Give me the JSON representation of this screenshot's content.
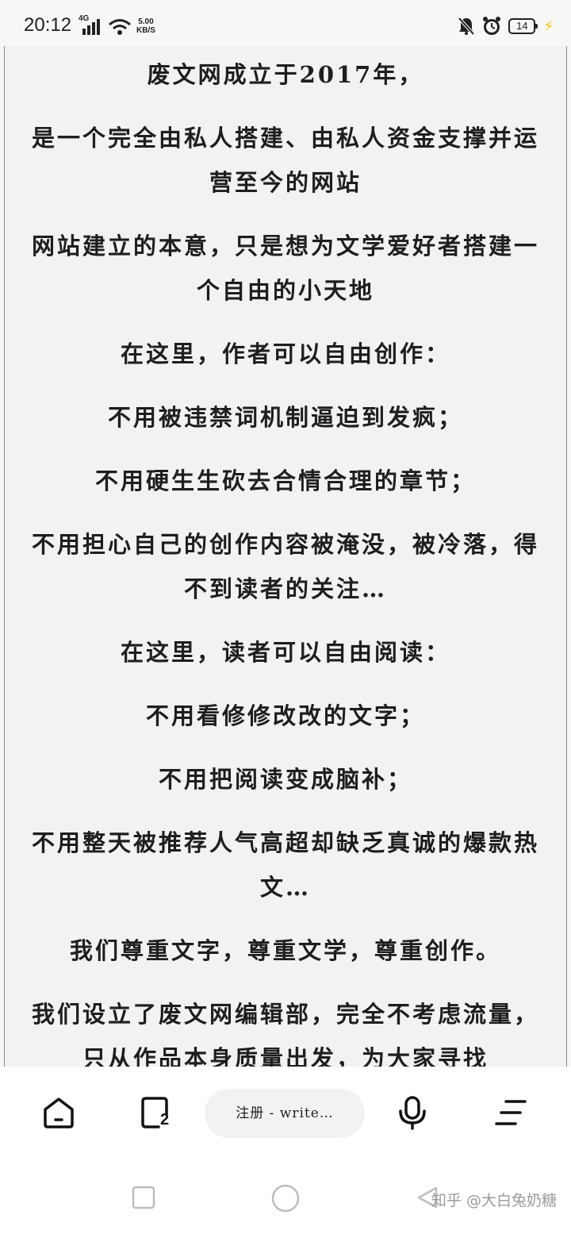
{
  "status_bar": {
    "time": "20:12",
    "network": "4G",
    "speed_value": "5.00",
    "speed_unit": "KB/S",
    "battery": "14"
  },
  "article": {
    "paragraphs": [
      "废文网成立于2017年，",
      "是一个完全由私人搭建、由私人资金支撑并运营至今的网站",
      "网站建立的本意，只是想为文学爱好者搭建一个自由的小天地",
      "在这里，作者可以自由创作：",
      "不用被违禁词机制逼迫到发疯；",
      "不用硬生生砍去合情合理的章节；",
      "不用担心自己的创作内容被淹没，被冷落，得不到读者的关注…",
      "在这里，读者可以自由阅读：",
      "不用看修修改改的文字；",
      "不用把阅读变成脑补；",
      "不用整天被推荐人气高超却缺乏真诚的爆款热文…",
      "我们尊重文字，尊重文学，尊重创作。",
      "我们设立了废文网编辑部，完全不考虑流量，只从作品本身质量出发，为大家寻找"
    ]
  },
  "toolbar": {
    "url_text": "注册 - write…",
    "tabs_count": "2",
    "icons": [
      "home-icon",
      "tabs-icon",
      "mic-icon",
      "menu-icon"
    ]
  },
  "navbar": {
    "watermark": "知乎 @大白兔奶糖"
  }
}
